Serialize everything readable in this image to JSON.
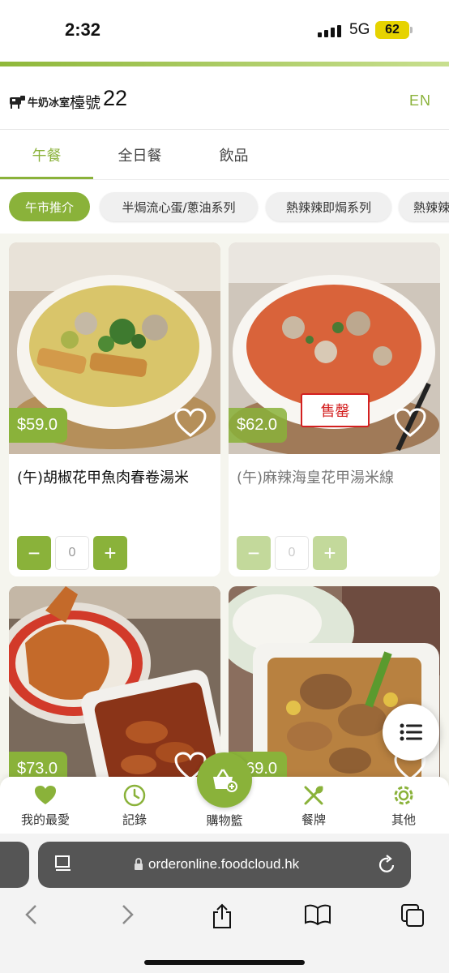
{
  "status_bar": {
    "time": "2:32",
    "network": "5G",
    "battery": "62"
  },
  "header": {
    "logo_text": "牛奶冰室",
    "table_label": "檯號",
    "table_number": "22",
    "language_toggle": "EN"
  },
  "tabs": [
    {
      "label": "午餐",
      "active": true
    },
    {
      "label": "全日餐",
      "active": false
    },
    {
      "label": "飲品",
      "active": false
    }
  ],
  "chips": [
    {
      "label": "午市推介",
      "active": true
    },
    {
      "label": "半焗流心蛋/蔥油系列",
      "active": false
    },
    {
      "label": "熱辣辣即焗系列",
      "active": false
    },
    {
      "label": "熱辣辣",
      "active": false
    }
  ],
  "products": [
    {
      "name": "(午)胡椒花甲魚肉春卷湯米",
      "price": "$59.0",
      "quantity": "0",
      "sold_out": false
    },
    {
      "name": "(午)麻辣海皇花甲湯米線",
      "price": "$62.0",
      "quantity": "0",
      "sold_out": true,
      "sold_out_label": "售罄"
    },
    {
      "name": "",
      "price": "$73.0",
      "quantity": "",
      "sold_out": false
    },
    {
      "name": "",
      "price": "$69.0",
      "quantity": "",
      "sold_out": false
    }
  ],
  "stepper": {
    "minus": "−",
    "plus": "+"
  },
  "bottom_nav": {
    "favorites": "我的最愛",
    "history": "記錄",
    "cart": "購物籃",
    "menu": "餐牌",
    "others": "其他"
  },
  "browser": {
    "url": "orderonline.foodcloud.hk"
  },
  "colors": {
    "accent": "#8ab23a",
    "sold_out": "#d32020"
  }
}
